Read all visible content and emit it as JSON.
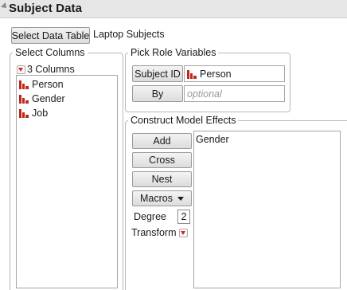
{
  "outline": {
    "title": "Subject Data"
  },
  "data_table": {
    "button_label": "Select Data Table",
    "name": "Laptop Subjects"
  },
  "select_columns": {
    "legend": "Select Columns",
    "count_label": "3 Columns",
    "columns": [
      {
        "name": "Person",
        "icon": "nominal-icon"
      },
      {
        "name": "Gender",
        "icon": "nominal-icon"
      },
      {
        "name": "Job",
        "icon": "nominal-icon"
      }
    ]
  },
  "pick_role": {
    "legend": "Pick Role Variables",
    "subject_id_label": "Subject ID",
    "subject_id_value": "Person",
    "by_label": "By",
    "by_placeholder": "optional"
  },
  "construct_model": {
    "legend": "Construct Model Effects",
    "add_label": "Add",
    "cross_label": "Cross",
    "nest_label": "Nest",
    "macros_label": "Macros",
    "degree_label": "Degree",
    "degree_value": "2",
    "transform_label": "Transform",
    "effects": [
      "Gender"
    ]
  },
  "colors": {
    "nominal_icon": "#c0281e",
    "red_arrow": "#d7261e",
    "header_bg": "#e6e6e6"
  }
}
